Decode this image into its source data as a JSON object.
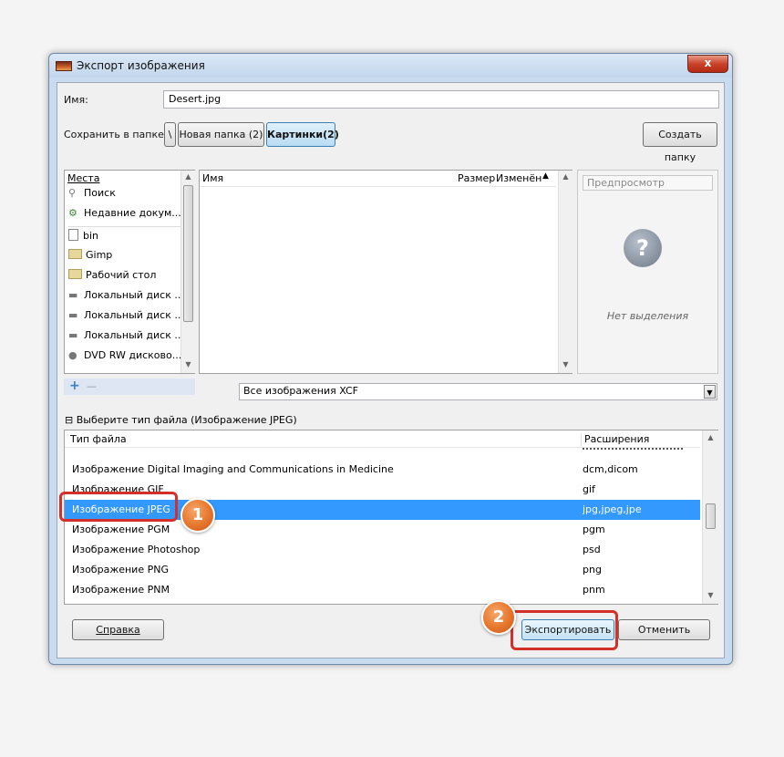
{
  "window": {
    "title": "Экспорт изображения",
    "close": "x"
  },
  "name_field": {
    "label": "Имя:",
    "value": "Desert.jpg"
  },
  "save_in": {
    "label": "Сохранить в папке",
    "path": [
      "\\",
      "Новая папка (2)",
      "Картинки(2)"
    ],
    "create_folder": "Создать папку"
  },
  "places": {
    "header": "Места",
    "items": [
      {
        "label": "Поиск",
        "icon": "search-icon"
      },
      {
        "label": "Недавние докум...",
        "icon": "recent-icon"
      },
      {
        "label": "bin",
        "icon": "file-icon"
      },
      {
        "label": "Gimp",
        "icon": "folder-icon"
      },
      {
        "label": "Рабочий стол",
        "icon": "folder-icon"
      },
      {
        "label": "Локальный диск ...",
        "icon": "drive-icon"
      },
      {
        "label": "Локальный диск ...",
        "icon": "drive-icon"
      },
      {
        "label": "Локальный диск ...",
        "icon": "drive-icon"
      },
      {
        "label": "DVD RW дисково...",
        "icon": "dvd-icon"
      }
    ],
    "add": "+",
    "remove": "—"
  },
  "files": {
    "col_name": "Имя",
    "col_size": "Размер",
    "col_modified": "Изменён"
  },
  "preview": {
    "label": "Предпросмотр",
    "empty": "Нет выделения"
  },
  "filter": {
    "value": "Все изображения XCF"
  },
  "filetype": {
    "toggle": "⊟",
    "header": "Выберите тип файла (Изображение JPEG)",
    "col_type": "Тип файла",
    "col_ext": "Расширения",
    "rows": [
      {
        "name": "Изображение Digital Imaging and Communications in Medicine",
        "ext": "dcm,dicom"
      },
      {
        "name": "Изображение GIF",
        "ext": "gif"
      },
      {
        "name": "Изображение JPEG",
        "ext": "jpg,jpeg,jpe"
      },
      {
        "name": "Изображение PGM",
        "ext": "pgm"
      },
      {
        "name": "Изображение Photoshop",
        "ext": "psd"
      },
      {
        "name": "Изображение PNG",
        "ext": "png"
      },
      {
        "name": "Изображение PNM",
        "ext": "pnm"
      }
    ]
  },
  "buttons": {
    "help": "Справка",
    "export": "Экспортировать",
    "cancel": "Отменить"
  },
  "callouts": {
    "first": "1",
    "second": "2"
  },
  "colors": {
    "selection": "#3399ff",
    "callout": "#d4302a",
    "badge": "#e6762c"
  }
}
